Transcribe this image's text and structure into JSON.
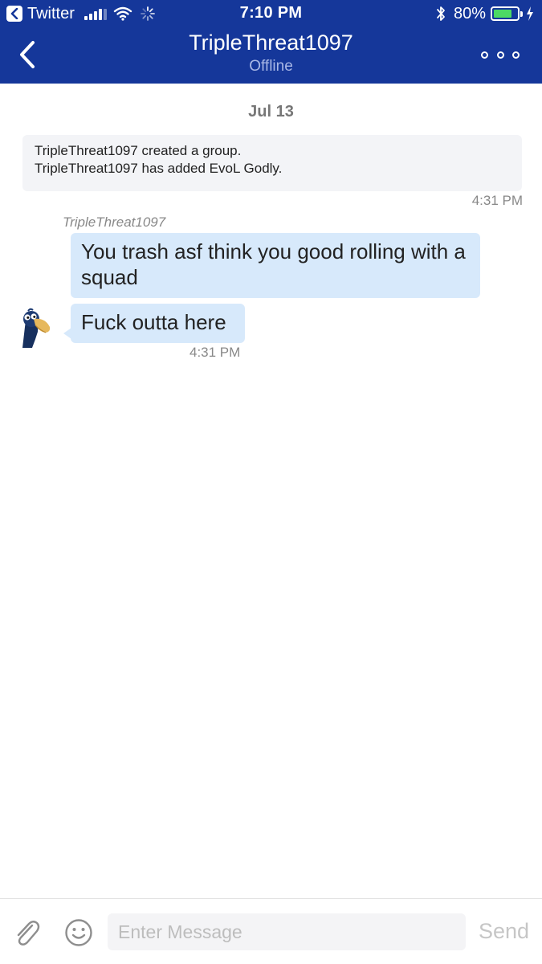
{
  "status_bar": {
    "back_app_label": "Twitter",
    "time": "7:10 PM",
    "battery_percent": "80%",
    "battery_level": 0.8,
    "battery_color": "#4cd964",
    "icons": [
      "back-to-app-icon",
      "cellular-signal-icon",
      "wifi-icon",
      "activity-spinner-icon",
      "bluetooth-icon",
      "battery-icon",
      "charging-icon"
    ]
  },
  "nav": {
    "title": "TripleThreat1097",
    "subtitle": "Offline",
    "background_color": "#15379a",
    "icons": [
      "back-chevron-icon",
      "more-options-icon"
    ]
  },
  "conversation": {
    "date_separator": "Jul 13",
    "system_messages": [
      "TripleThreat1097 created a group.",
      "TripleThreat1097 has added EvoL Godly."
    ],
    "system_time": "4:31 PM",
    "sender_name": "TripleThreat1097",
    "messages": [
      {
        "text": "You trash asf think you good rolling with a squad"
      },
      {
        "text": "Fuck outta here"
      }
    ],
    "message_time": "4:31 PM",
    "bubble_color": "#d7e9fb"
  },
  "composer": {
    "placeholder": "Enter Message",
    "send_label": "Send",
    "icons": [
      "paperclip-icon",
      "emoji-icon"
    ]
  }
}
